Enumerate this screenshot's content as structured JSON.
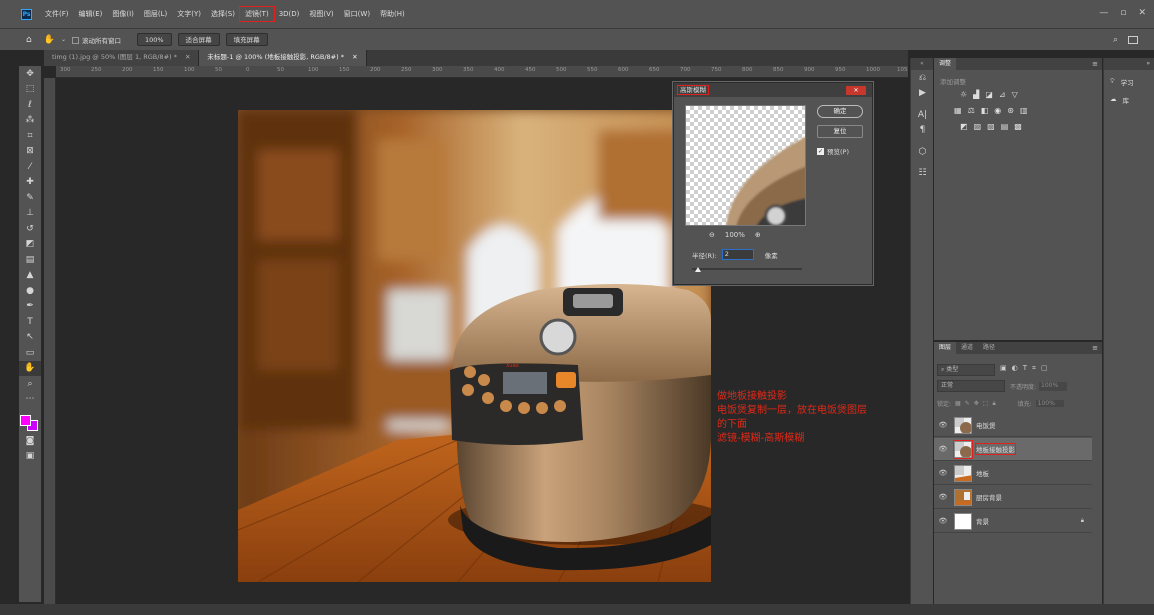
{
  "menubar": {
    "logo": "Ps",
    "items": [
      "文件(F)",
      "编辑(E)",
      "图像(I)",
      "图层(L)",
      "文字(Y)",
      "选择(S)",
      "滤镜(T)",
      "3D(D)",
      "视图(V)",
      "窗口(W)",
      "帮助(H)"
    ],
    "highlight_index": 6,
    "window_controls": [
      "—",
      "▫",
      "✕"
    ]
  },
  "options": {
    "scroll_all": "滚动所有窗口",
    "zoom": "100%",
    "fit_screen": "适合屏幕",
    "fill_screen": "填充屏幕"
  },
  "tabs": [
    "timg (1).jpg @ 50% (图层 1, RGB/8#) *",
    "未标题-1 @ 100% (地板接触投影, RGB/8#) *"
  ],
  "ruler": [
    "300",
    "250",
    "200",
    "150",
    "100",
    "50",
    "0",
    "50",
    "100",
    "150",
    "200",
    "250",
    "300",
    "350",
    "400",
    "450",
    "500",
    "550",
    "600",
    "650",
    "700",
    "750",
    "800",
    "850",
    "900",
    "950",
    "1000",
    "1050",
    "110"
  ],
  "dialog": {
    "title": "高斯模糊",
    "close": "✕",
    "ok": "确定",
    "reset": "复位",
    "preview_label": "预览(P)",
    "zoom_level": "100%",
    "radius_label": "半径(R):",
    "radius_value": "2",
    "unit": "像素",
    "radius_fraction": 0.03
  },
  "annotation": {
    "line1": "做地板接触投影",
    "line2": "电饭煲复制一层，放在电饭煲图层",
    "line3": "的下面",
    "line4": "滤镜-模糊-高斯模糊"
  },
  "adjust_panel": {
    "tab": "调整",
    "label": "添加调整"
  },
  "right_col": {
    "learn": "学习",
    "library": "库"
  },
  "layers_panel": {
    "tabs": [
      "图层",
      "通道",
      "路径"
    ],
    "kind": "类型",
    "blend": "正常",
    "opacity_label": "不透明度:",
    "opacity": "100%",
    "lock_label": "锁定:",
    "fill_label": "填充:",
    "fill": "100%",
    "layers": [
      {
        "name": "电饭煲",
        "thumb": "cooker"
      },
      {
        "name": "地板接触投影",
        "thumb": "cooker"
      },
      {
        "name": "地板",
        "thumb": "floor"
      },
      {
        "name": "厨房背景",
        "thumb": "kitchen"
      },
      {
        "name": "背景",
        "thumb": "white"
      }
    ],
    "selected_index": 1
  },
  "colors": {
    "foreground": "#ff00ff",
    "background": "#cc00ff",
    "highlight": "#e0221e"
  },
  "cooker_brand": "Xuao"
}
